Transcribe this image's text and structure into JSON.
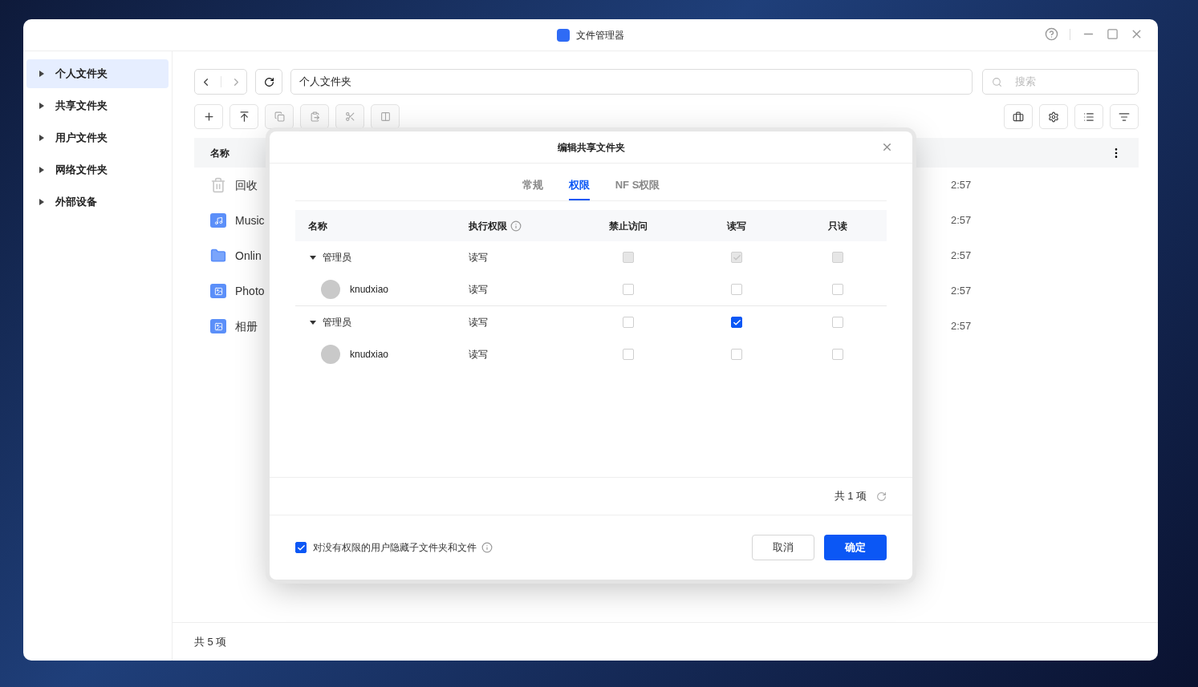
{
  "window": {
    "title": "文件管理器"
  },
  "sidebar": {
    "items": [
      {
        "label": "个人文件夹",
        "selected": true
      },
      {
        "label": "共享文件夹",
        "selected": false
      },
      {
        "label": "用户文件夹",
        "selected": false
      },
      {
        "label": "网络文件夹",
        "selected": false
      },
      {
        "label": "外部设备",
        "selected": false
      }
    ]
  },
  "path_bar": {
    "value": "个人文件夹"
  },
  "search": {
    "placeholder": "搜索"
  },
  "file_list": {
    "columns": [
      "名称"
    ],
    "rows": [
      {
        "name": "回收",
        "kind": "trash",
        "time": "2:57"
      },
      {
        "name": "Music",
        "kind": "music",
        "time": "2:57"
      },
      {
        "name": "Onlin",
        "kind": "folder",
        "time": "2:57"
      },
      {
        "name": "Photo",
        "kind": "photo",
        "time": "2:57"
      },
      {
        "name": "相册",
        "kind": "photo",
        "time": "2:57"
      }
    ]
  },
  "status_bar": "共 5 项",
  "dialog": {
    "title": "编辑共享文件夹",
    "tabs": [
      {
        "label": "常规",
        "selected": false
      },
      {
        "label": "权限",
        "selected": true
      },
      {
        "label": "NF S权限",
        "selected": false
      }
    ],
    "columns": [
      "名称",
      "执行权限",
      "禁止访问",
      "读写",
      "只读"
    ],
    "rows": [
      {
        "name": "管理员",
        "kind": "group",
        "expanded": true,
        "exec": "读写",
        "deny": {
          "checked": false,
          "disabled": true
        },
        "read_write": {
          "checked": true,
          "disabled": true
        },
        "read_only": {
          "checked": false,
          "disabled": true
        },
        "children": [
          {
            "name": "knudxiao",
            "kind": "user",
            "exec": "读写",
            "deny": {
              "checked": false,
              "disabled": false
            },
            "read_write": {
              "checked": false,
              "disabled": false
            },
            "read_only": {
              "checked": false,
              "disabled": false
            }
          }
        ]
      },
      {
        "name": "管理员",
        "kind": "group",
        "expanded": true,
        "exec": "读写",
        "deny": {
          "checked": false,
          "disabled": false
        },
        "read_write": {
          "checked": true,
          "disabled": false
        },
        "read_only": {
          "checked": false,
          "disabled": false
        },
        "children": [
          {
            "name": "knudxiao",
            "kind": "user",
            "exec": "读写",
            "deny": {
              "checked": false,
              "disabled": false
            },
            "read_write": {
              "checked": false,
              "disabled": false
            },
            "read_only": {
              "checked": false,
              "disabled": false
            }
          }
        ]
      }
    ],
    "count": "共 1 项",
    "hide_option": {
      "label": "对没有权限的用户隐藏子文件夹和文件",
      "checked": true
    },
    "buttons": {
      "cancel": "取消",
      "ok": "确定"
    }
  }
}
